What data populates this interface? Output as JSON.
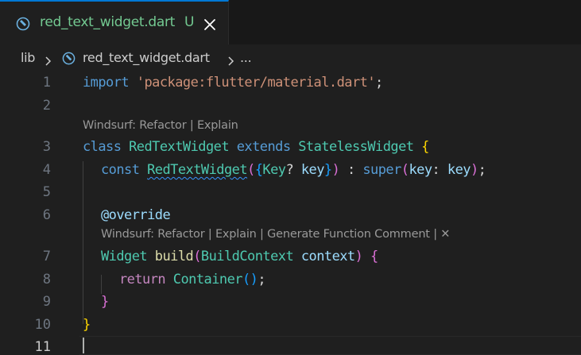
{
  "tab": {
    "filename": "red_text_widget.dart",
    "status": "U",
    "icon": "dart-file-icon",
    "close_icon": "close-icon"
  },
  "breadcrumb": {
    "folder": "lib",
    "file": "red_text_widget.dart",
    "more": "..."
  },
  "editor": {
    "line_numbers": [
      "1",
      "2",
      "3",
      "4",
      "5",
      "6",
      "7",
      "8",
      "9",
      "10",
      "11"
    ],
    "active_line": "11",
    "code_lens": {
      "class_lens": "Windsurf: Refactor | Explain",
      "method_lens": "Windsurf: Refactor | Explain | Generate Function Comment | ✕"
    },
    "tokens": {
      "import_kw": "import",
      "import_str": "'package:flutter/material.dart'",
      "semicolon": ";",
      "class_kw": "class",
      "class_name": "RedTextWidget",
      "extends_kw": "extends",
      "super_class": "StatelessWidget",
      "open_brace": "{",
      "const_kw": "const",
      "ctor_name": "RedTextWidget",
      "paren_open": "(",
      "brace_open": "{",
      "key_type": "Key",
      "question": "?",
      "key_param": "key",
      "brace_close": "}",
      "paren_close": ")",
      "colon": " : ",
      "super_kw": "super",
      "super_paren_open": "(",
      "named_key": "key",
      "named_colon": ": ",
      "key_value": "key",
      "super_paren_close": ")",
      "override": "@override",
      "widget_type": "Widget",
      "build_fn": "build",
      "build_paren_open": "(",
      "ctx_type": "BuildContext",
      "ctx_param": "context",
      "build_paren_close": ")",
      "build_brace": "{",
      "return_kw": "return",
      "container": "Container",
      "container_parens": "()",
      "method_close": "}",
      "class_close": "}"
    }
  },
  "colors": {
    "background": "#1f1f1f",
    "keyword": "#569cd6",
    "control_keyword": "#c586c0",
    "string": "#ce9178",
    "class": "#4ec9b0",
    "function": "#dcdcaa",
    "variable": "#9cdcfe",
    "untracked": "#73c991",
    "accent": "#0078d4"
  }
}
